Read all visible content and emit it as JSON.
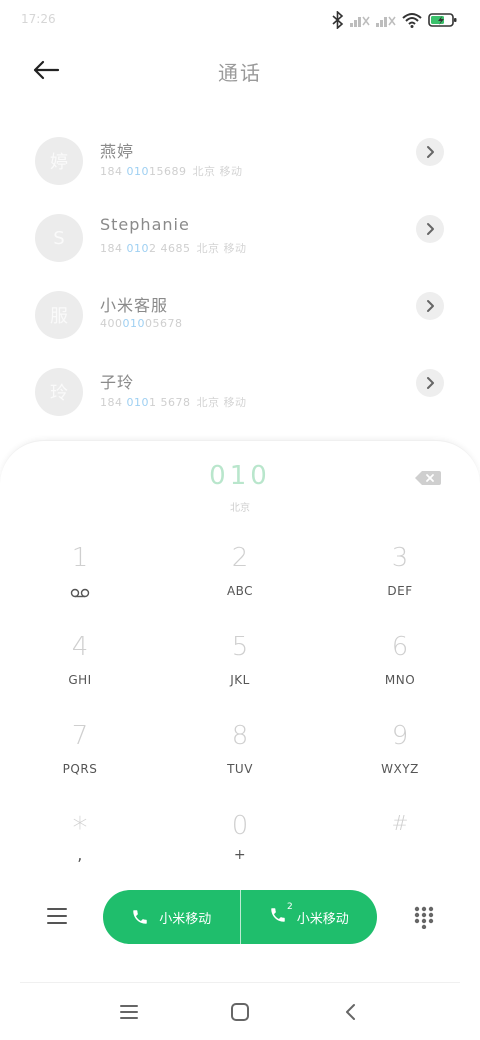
{
  "status_bar": {
    "time": "17:26"
  },
  "header": {
    "title": "通话"
  },
  "contacts": [
    {
      "avatar": "婷",
      "name": "燕婷",
      "number_pre": "184 ",
      "number_hl": "010",
      "number_post": "15689",
      "location": "北京 移动"
    },
    {
      "avatar": "S",
      "name": "Stephanie",
      "number_pre": "184 ",
      "number_hl": "010",
      "number_post": "2 4685",
      "location": "北京 移动"
    },
    {
      "avatar": "服",
      "name": "小米客服",
      "number_pre": "400",
      "number_hl": "010",
      "number_post": "05678",
      "location": ""
    },
    {
      "avatar": "玲",
      "name": "子玲",
      "number_pre": "184 ",
      "number_hl": "010",
      "number_post": "1 5678",
      "location": "北京 移动"
    }
  ],
  "dialer": {
    "number": "010",
    "location": "北京",
    "keys": [
      {
        "digit": "1",
        "letters": ""
      },
      {
        "digit": "2",
        "letters": "ABC"
      },
      {
        "digit": "3",
        "letters": "DEF"
      },
      {
        "digit": "4",
        "letters": "GHI"
      },
      {
        "digit": "5",
        "letters": "JKL"
      },
      {
        "digit": "6",
        "letters": "MNO"
      },
      {
        "digit": "7",
        "letters": "PQRS"
      },
      {
        "digit": "8",
        "letters": "TUV"
      },
      {
        "digit": "9",
        "letters": "WXYZ"
      },
      {
        "digit": "*",
        "letters": ","
      },
      {
        "digit": "0",
        "letters": "+"
      },
      {
        "digit": "#",
        "letters": ""
      }
    ]
  },
  "call_bar": {
    "sim1_label": "小米移动",
    "sim2_label": "小米移动",
    "sim2_badge": "2"
  },
  "colors": {
    "accent": "#1fbe6c",
    "highlight": "#9fd0f2"
  }
}
